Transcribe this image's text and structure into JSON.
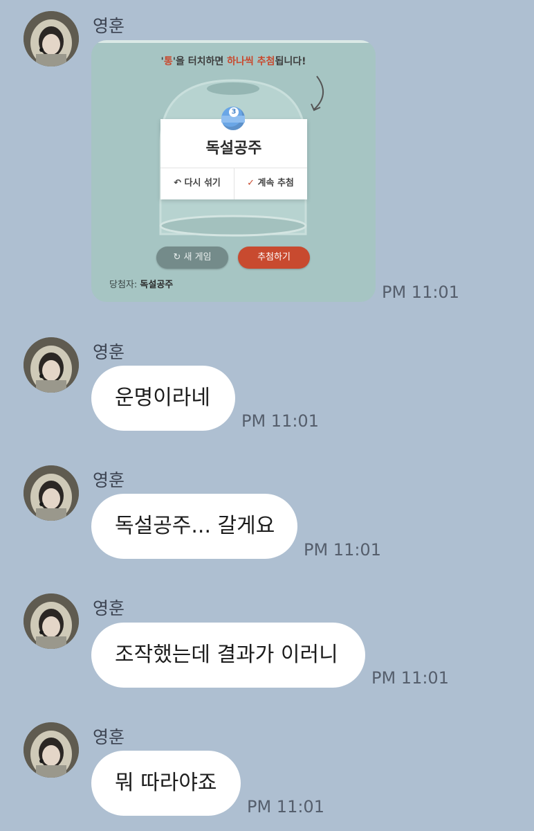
{
  "colors": {
    "background": "#aebfd1",
    "bubble": "#ffffff",
    "card_bg": "#a6c5c3",
    "accent_red": "#c84a2f",
    "button_gray": "#748b8a"
  },
  "messages": [
    {
      "sender": "영훈",
      "type": "card",
      "time": "PM 11:01",
      "card": {
        "instruction_prefix": "'",
        "instruction_highlight1": "통",
        "instruction_mid": "'을 터치하면 ",
        "instruction_highlight2": "하나씩 추첨",
        "instruction_suffix": "됩니다!",
        "ball_number": "3",
        "result_title": "독설공주",
        "reshuffle_label": "다시 섞기",
        "continue_label": "계속 추첨",
        "new_game_label": "새 게임",
        "draw_label": "추첨하기",
        "winner_label": "당첨자:",
        "winner_value": "독설공주"
      }
    },
    {
      "sender": "영훈",
      "type": "text",
      "text": "운명이라네",
      "time": "PM 11:01"
    },
    {
      "sender": "영훈",
      "type": "text",
      "text": "독설공주... 갈게요",
      "time": "PM 11:01"
    },
    {
      "sender": "영훈",
      "type": "text",
      "text": "조작했는데 결과가 이러니",
      "time": "PM 11:01"
    },
    {
      "sender": "영훈",
      "type": "text",
      "text": "뭐 따라야죠",
      "time": "PM 11:01"
    }
  ],
  "icons": {
    "avatar": "profile-photo-icon",
    "reshuffle": "undo-arrow-icon",
    "continue": "checkmark-icon",
    "new_game": "refresh-icon",
    "hint_arrow": "curved-arrow-icon"
  }
}
